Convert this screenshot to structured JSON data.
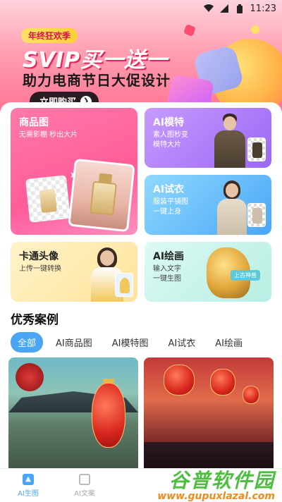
{
  "status_bar": {
    "time": "11:23"
  },
  "banner": {
    "badge": "年终狂欢季",
    "headline": "SVIP买一送一",
    "subheadline": "助力电商节日大促设计",
    "cta": "立即购买"
  },
  "features": {
    "product": {
      "title": "商品图",
      "desc": "无需影棚 秒出大片"
    },
    "model": {
      "title": "AI模特",
      "desc_line1": "素人图秒变",
      "desc_line2": "模特大片"
    },
    "tryon": {
      "title": "AI试衣",
      "desc_line1": "服装平铺图",
      "desc_line2": "一键上身"
    },
    "cartoon": {
      "title": "卡通头像",
      "desc": "上传一键转换"
    },
    "paint": {
      "title": "AI绘画",
      "desc_line1": "输入文字",
      "desc_line2": "一键生图",
      "chip": "上古神兽"
    }
  },
  "section": {
    "title": "优秀案例",
    "tabs": [
      "全部",
      "AI商品图",
      "AI模特图",
      "AI试衣",
      "AI绘画"
    ]
  },
  "bottom_nav": {
    "items": [
      {
        "label": "AI生图",
        "icon": "image-icon"
      },
      {
        "label": "AI文案",
        "icon": "document-icon"
      }
    ]
  },
  "watermark": {
    "main": "谷普软件园",
    "sub": "www.gupuxlazal.com"
  },
  "colors": {
    "accent": "#4aa6f5",
    "pink": "#ff5c9a",
    "purple": "#9c67f5"
  }
}
